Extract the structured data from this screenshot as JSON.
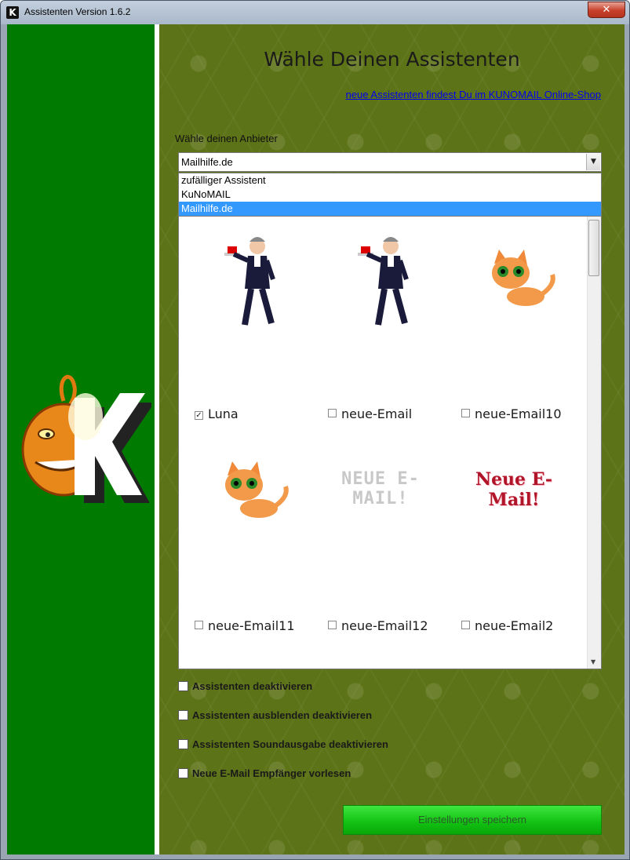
{
  "window": {
    "title": "Assistenten Version 1.6.2",
    "close_label": "✕"
  },
  "main": {
    "heading": "Wähle Deinen Assistenten",
    "shop_link": "neue Assistenten findest Du im KUNOMAIL Online-Shop",
    "provider_label": "Wähle deinen Anbieter",
    "provider_select": {
      "value": "Mailhilfe.de",
      "options": [
        {
          "label": "zufälliger Assistent",
          "selected": false
        },
        {
          "label": "KuNoMAIL",
          "selected": false
        },
        {
          "label": "Mailhilfe.de",
          "selected": true
        }
      ]
    },
    "assistants": [
      {
        "name": "Luna",
        "checked": true,
        "picture": "butler-icon"
      },
      {
        "name": "neue-Email",
        "checked": false,
        "picture": "butler-icon"
      },
      {
        "name": "neue-Email10",
        "checked": false,
        "picture": "cat-icon"
      },
      {
        "name": "neue-Email11",
        "checked": false,
        "picture": "cat-icon"
      },
      {
        "name": "neue-Email12",
        "checked": false,
        "picture": "text-art",
        "art_text": "NEUE E-MAIL!"
      },
      {
        "name": "neue-Email2",
        "checked": false,
        "picture": "text-art",
        "art_text": "Neue E-Mail!"
      }
    ],
    "options": [
      {
        "label": "Assistenten deaktivieren",
        "checked": false
      },
      {
        "label": "Assistenten ausblenden deaktivieren",
        "checked": false
      },
      {
        "label": "Assistenten Soundausgabe deaktivieren",
        "checked": false
      },
      {
        "label": "Neue E-Mail Empfänger vorlesen",
        "checked": false
      }
    ],
    "save_button": "Einstellungen speichern"
  },
  "sidebar": {
    "logo_letter": "K"
  },
  "colors": {
    "sidebar": "#007a00",
    "main_bg": "#5d7317",
    "selection": "#3399ff",
    "save_button": "#22cc22",
    "link": "#0000ee"
  }
}
